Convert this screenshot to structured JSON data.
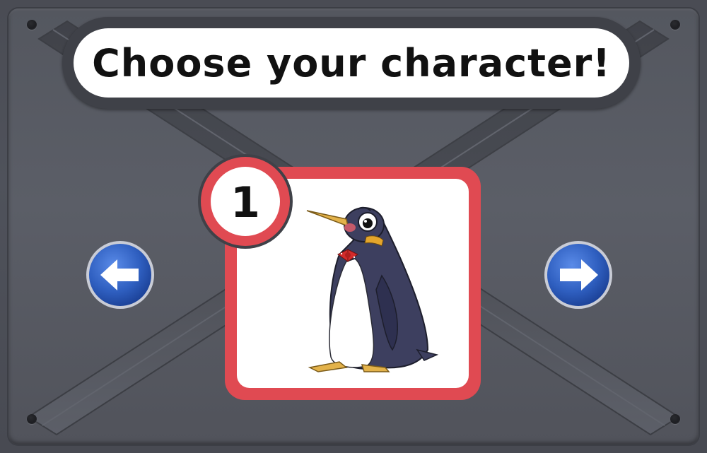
{
  "title": {
    "text": "Choose your character!"
  },
  "character_card": {
    "number": "1",
    "character": "penguin",
    "accent_color": "#e04a52"
  },
  "navigation": {
    "prev_icon": "arrow-left-icon",
    "next_icon": "arrow-right-icon",
    "button_color": "#2f5fc0"
  },
  "panel": {
    "background_color": "#54575f",
    "frame_color": "#3f4148"
  }
}
